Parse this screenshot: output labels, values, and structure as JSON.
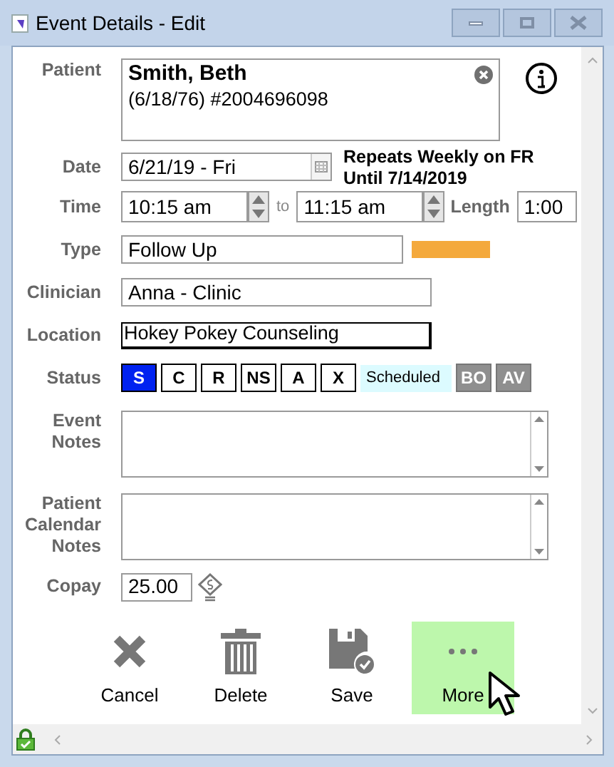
{
  "window": {
    "title": "Event Details - Edit"
  },
  "patient": {
    "label": "Patient",
    "name": "Smith, Beth",
    "details": "(6/18/76) #2004696098"
  },
  "date": {
    "label": "Date",
    "value": "6/21/19 - Fri",
    "recurrence": "Repeats Weekly on FR Until 7/14/2019"
  },
  "time": {
    "label": "Time",
    "start": "10:15 am",
    "separator": "to",
    "end": "11:15 am",
    "length_label": "Length",
    "length": "1:00"
  },
  "type": {
    "label": "Type",
    "value": "Follow Up",
    "color": "#f4a93c"
  },
  "clinician": {
    "label": "Clinician",
    "value": "Anna - Clinic"
  },
  "location": {
    "label": "Location",
    "value": "Hokey Pokey Counseling"
  },
  "status": {
    "label": "Status",
    "state_text": "Scheduled",
    "options": [
      {
        "label": "S",
        "selected": true,
        "disabled": false
      },
      {
        "label": "C",
        "selected": false,
        "disabled": false
      },
      {
        "label": "R",
        "selected": false,
        "disabled": false
      },
      {
        "label": "NS",
        "selected": false,
        "disabled": false
      },
      {
        "label": "A",
        "selected": false,
        "disabled": false
      },
      {
        "label": "X",
        "selected": false,
        "disabled": false
      },
      {
        "label": "BO",
        "selected": false,
        "disabled": true
      },
      {
        "label": "AV",
        "selected": false,
        "disabled": true
      }
    ]
  },
  "event_notes": {
    "label": "Event Notes"
  },
  "patient_calendar_notes": {
    "label": "Patient Calendar Notes"
  },
  "copay": {
    "label": "Copay",
    "value": "25.00"
  },
  "actions": [
    {
      "kind": "cancel",
      "label": "Cancel",
      "highlighted": false
    },
    {
      "kind": "delete",
      "label": "Delete",
      "highlighted": false
    },
    {
      "kind": "save",
      "label": "Save",
      "highlighted": false
    },
    {
      "kind": "more",
      "label": "More",
      "highlighted": true
    }
  ]
}
